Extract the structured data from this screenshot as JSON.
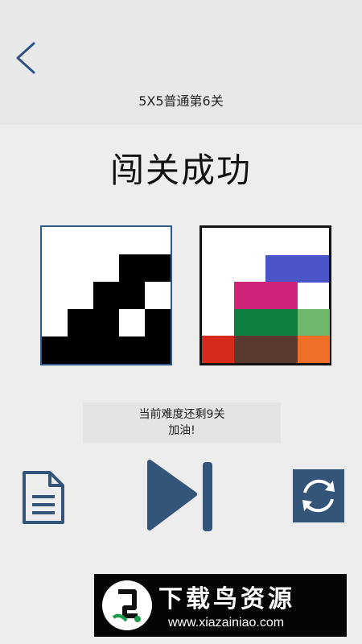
{
  "header": {
    "back_icon": "chevron-left-icon",
    "level_title": "5X5普通第6关"
  },
  "result": {
    "title": "闯关成功"
  },
  "boards": {
    "target_grid": [
      [
        0,
        0,
        0,
        0,
        0
      ],
      [
        0,
        0,
        0,
        1,
        1
      ],
      [
        0,
        0,
        1,
        1,
        0
      ],
      [
        0,
        1,
        1,
        0,
        1
      ],
      [
        1,
        1,
        1,
        1,
        1
      ]
    ],
    "result_rows": 5,
    "result_cols": 4,
    "result_cells": [
      {
        "row": 1,
        "col": 2,
        "span": 2,
        "color": "#4b55c8"
      },
      {
        "row": 2,
        "col": 1,
        "span": 2,
        "color": "#d0237a"
      },
      {
        "row": 3,
        "col": 1,
        "span": 2,
        "color": "#0d8040"
      },
      {
        "row": 3,
        "col": 3,
        "span": 1,
        "color": "#6fb86b"
      },
      {
        "row": 4,
        "col": 0,
        "span": 1,
        "color": "#d52a1c"
      },
      {
        "row": 4,
        "col": 1,
        "span": 2,
        "color": "#5a3a30"
      },
      {
        "row": 4,
        "col": 3,
        "span": 1,
        "color": "#f06f28"
      }
    ]
  },
  "message": {
    "line1": "当前难度还剩9关",
    "line2": "加油!"
  },
  "actions": {
    "doc_icon": "document-icon",
    "next_icon": "next-level-icon",
    "refresh_icon": "refresh-icon"
  },
  "banner": {
    "title": "下载鸟资源",
    "url": "www.xiazainiao.com"
  },
  "colors": {
    "accent": "#34557a",
    "background": "#ededed"
  }
}
